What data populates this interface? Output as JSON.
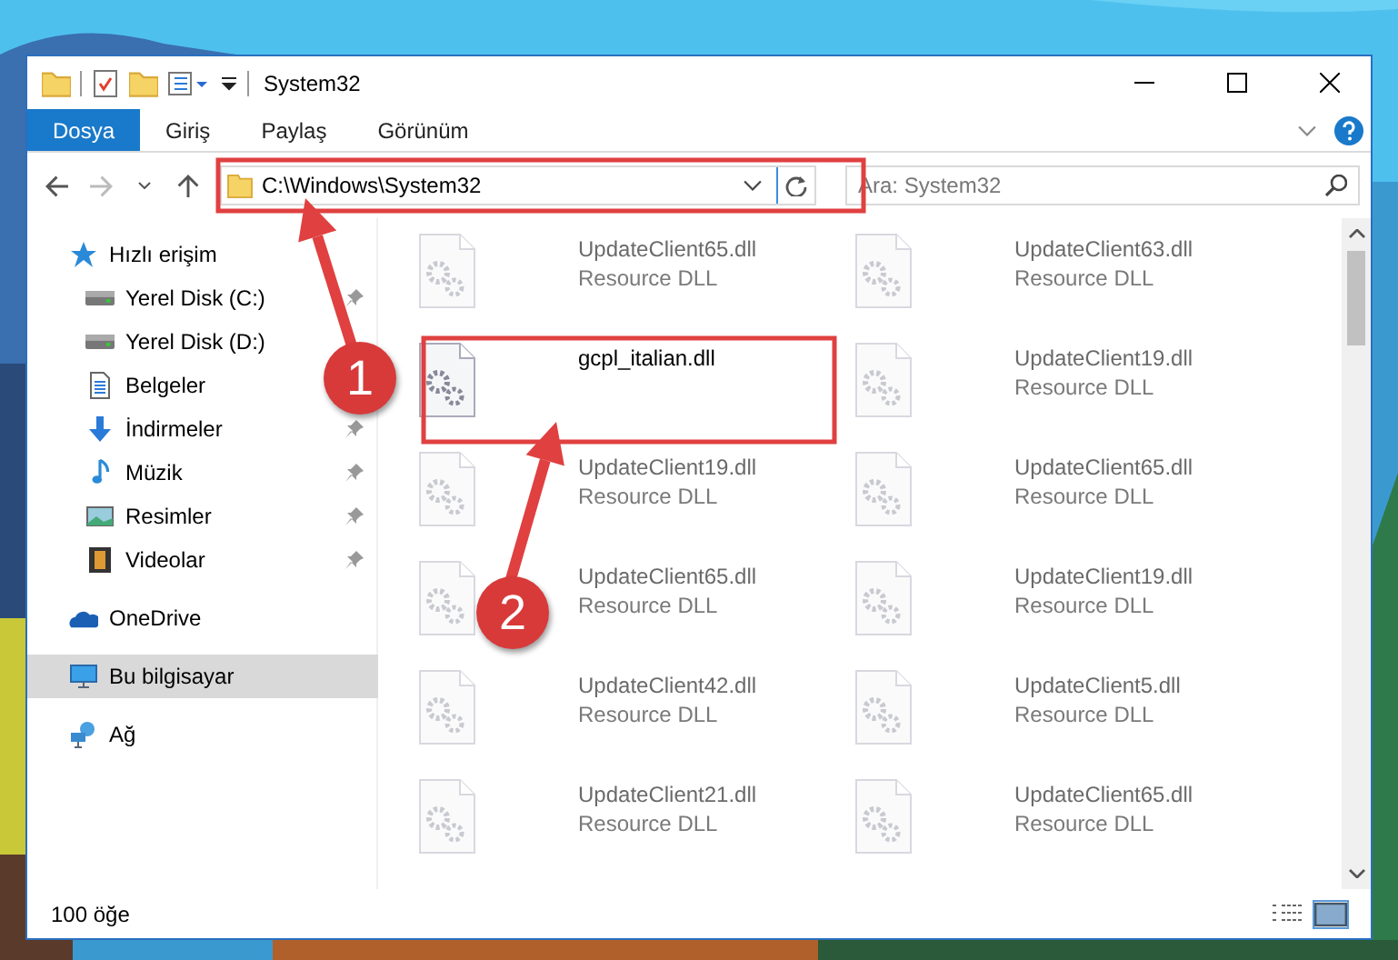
{
  "window": {
    "title": "System32"
  },
  "ribbon_tabs": [
    {
      "label": "Dosya",
      "selected": true
    },
    {
      "label": "Giriş",
      "selected": false
    },
    {
      "label": "Paylaş",
      "selected": false
    },
    {
      "label": "Görünüm",
      "selected": false
    }
  ],
  "address_bar": {
    "path": "C:\\Windows\\System32"
  },
  "search": {
    "placeholder": "Ara: System32"
  },
  "navigation": [
    {
      "label": "Hızlı erişim",
      "kind": "star",
      "selected": false,
      "children": [
        {
          "label": "Yerel Disk (C:)",
          "kind": "drive",
          "pinned": true
        },
        {
          "label": "Yerel Disk (D:)",
          "kind": "drive",
          "pinned": false
        },
        {
          "label": "Belgeler",
          "kind": "document",
          "pinned": false
        },
        {
          "label": "İndirmeler",
          "kind": "download",
          "pinned": true
        },
        {
          "label": "Müzik",
          "kind": "music",
          "pinned": true
        },
        {
          "label": "Resimler",
          "kind": "pictures",
          "pinned": true
        },
        {
          "label": "Videolar",
          "kind": "video",
          "pinned": true
        }
      ]
    },
    {
      "label": "OneDrive",
      "kind": "cloud",
      "selected": false
    },
    {
      "label": "Bu bilgisayar",
      "kind": "computer",
      "selected": true
    },
    {
      "label": "Ağ",
      "kind": "network",
      "selected": false
    }
  ],
  "files": [
    {
      "name": "UpdateClient65.dll",
      "type": "Resource DLL",
      "dimmed": true
    },
    {
      "name": "UpdateClient63.dll",
      "type": "Resource DLL",
      "dimmed": true
    },
    {
      "name": "gcpl_italian.dll",
      "dimmed": false
    },
    {
      "name": "UpdateClient19.dll",
      "type": "Resource DLL",
      "dimmed": true
    },
    {
      "name": "UpdateClient19.dll",
      "type": "Resource DLL",
      "dimmed": true
    },
    {
      "name": "UpdateClient65.dll",
      "type": "Resource DLL",
      "dimmed": true
    },
    {
      "name": "UpdateClient65.dll",
      "type": "Resource DLL",
      "dimmed": true
    },
    {
      "name": "UpdateClient19.dll",
      "type": "Resource DLL",
      "dimmed": true
    },
    {
      "name": "UpdateClient42.dll",
      "type": "Resource DLL",
      "dimmed": true
    },
    {
      "name": "UpdateClient5.dll",
      "type": "Resource DLL",
      "dimmed": true
    },
    {
      "name": "UpdateClient21.dll",
      "type": "Resource DLL",
      "dimmed": true
    },
    {
      "name": "UpdateClient65.dll",
      "type": "Resource DLL",
      "dimmed": true
    }
  ],
  "status_bar": {
    "count": "100 öğe"
  },
  "callouts": [
    {
      "number": "1"
    },
    {
      "number": "2"
    }
  ]
}
